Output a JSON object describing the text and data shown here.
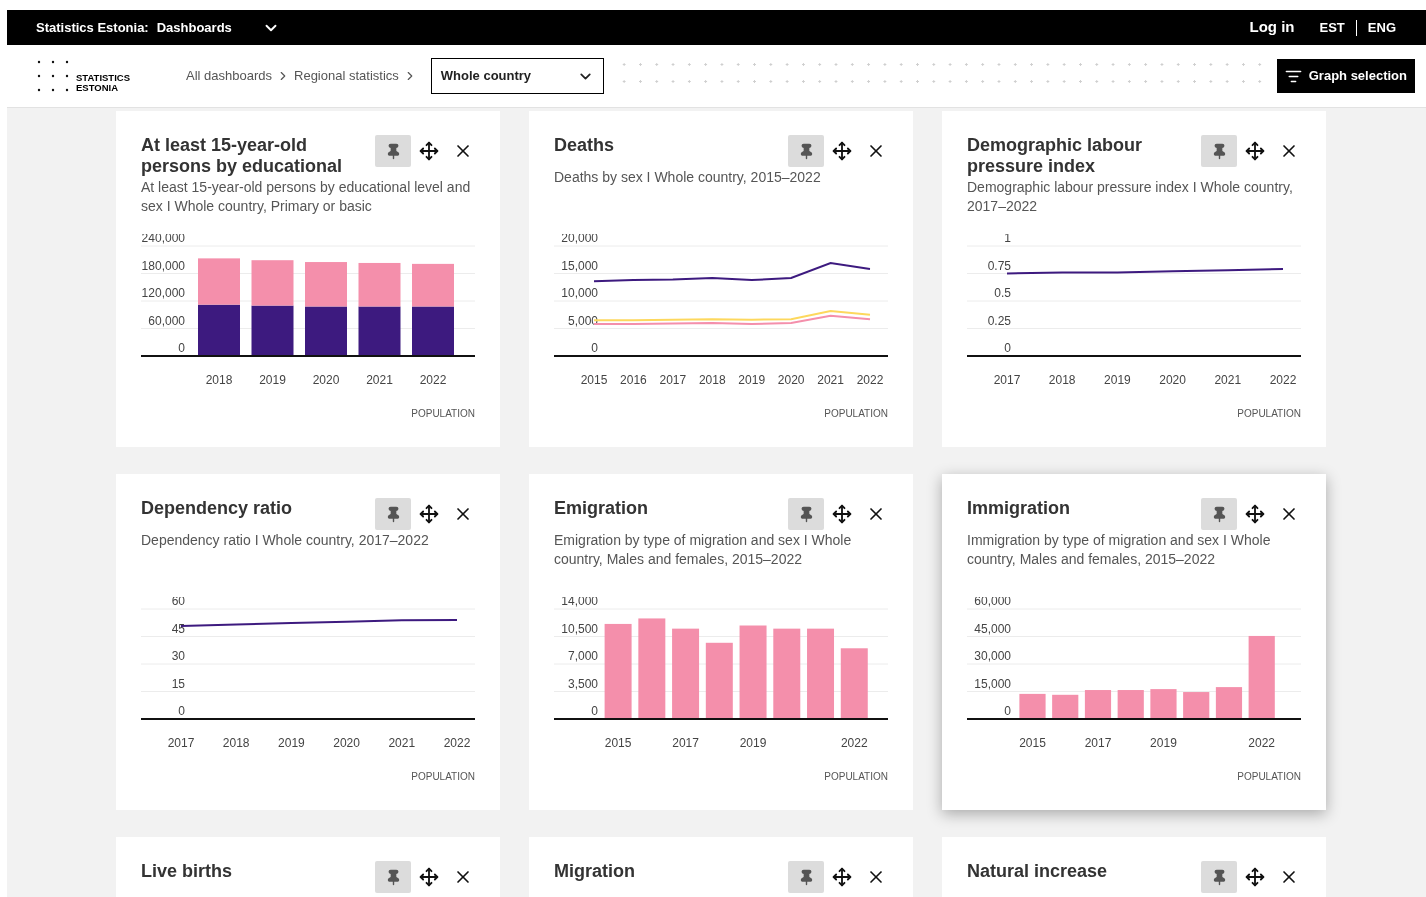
{
  "topbar": {
    "brand": "Statistics Estonia:",
    "section": "Dashboards",
    "login": "Log in",
    "languages": [
      "EST",
      "ENG"
    ]
  },
  "logo": {
    "lines": [
      "STATISTICS",
      "ESTONIA"
    ]
  },
  "breadcrumbs": [
    "All dashboards",
    "Regional statistics"
  ],
  "region_select": {
    "value": "Whole country"
  },
  "graph_selection_button": "Graph selection",
  "cards": [
    {
      "title": "At least 15-year-old persons by educational",
      "description": "At least 15-year-old persons by educational level and sex I Whole country, Primary or basic",
      "source": "POPULATION",
      "highlighted": false,
      "chart_data": {
        "type": "bar",
        "grid": true,
        "stacked": true,
        "categories": [
          "2018",
          "2019",
          "2020",
          "2021",
          "2022"
        ],
        "ylim": [
          0,
          240000
        ],
        "yticks": [
          {
            "value": 0,
            "label": "0"
          },
          {
            "value": 60000,
            "label": "60,000"
          },
          {
            "value": 120000,
            "label": "120,000"
          },
          {
            "value": 180000,
            "label": "180,000"
          },
          {
            "value": 240000,
            "label": "240,000"
          }
        ],
        "series": [
          {
            "color": "#3d1a7f",
            "values": [
              112000,
              110000,
              108000,
              108000,
              108000
            ]
          },
          {
            "color": "#f48fab",
            "values": [
              101000,
              99000,
              97000,
              95000,
              93000
            ]
          }
        ]
      }
    },
    {
      "title": "Deaths",
      "description": "Deaths by sex I Whole country, 2015–2022",
      "source": "POPULATION",
      "highlighted": false,
      "chart_data": {
        "type": "line",
        "grid": true,
        "categories": [
          "2015",
          "2016",
          "2017",
          "2018",
          "2019",
          "2020",
          "2021",
          "2022"
        ],
        "ylim": [
          0,
          20000
        ],
        "yticks": [
          {
            "value": 0,
            "label": "0"
          },
          {
            "value": 5000,
            "label": "5,000"
          },
          {
            "value": 10000,
            "label": "10,000"
          },
          {
            "value": 15000,
            "label": "15,000"
          },
          {
            "value": 20000,
            "label": "20,000"
          }
        ],
        "series": [
          {
            "color": "#3d1a7f",
            "values": [
              13600,
              13800,
              13900,
              14200,
              13800,
              14200,
              16900,
              15800
            ]
          },
          {
            "color": "#fdd85d",
            "values": [
              6500,
              6500,
              6600,
              6700,
              6600,
              6700,
              8200,
              7500
            ]
          },
          {
            "color": "#f48fab",
            "values": [
              5800,
              5800,
              5900,
              6000,
              5800,
              6000,
              7300,
              6700
            ]
          }
        ]
      }
    },
    {
      "title": "Demographic labour pressure index",
      "description": "Demographic labour pressure index I Whole country, 2017–2022",
      "source": "POPULATION",
      "highlighted": false,
      "chart_data": {
        "type": "line",
        "grid": true,
        "categories": [
          "2017",
          "2018",
          "2019",
          "2020",
          "2021",
          "2022"
        ],
        "ylim": [
          0,
          1
        ],
        "yticks": [
          {
            "value": 0,
            "label": "0"
          },
          {
            "value": 0.25,
            "label": "0.25"
          },
          {
            "value": 0.5,
            "label": "0.5"
          },
          {
            "value": 0.75,
            "label": "0.75"
          },
          {
            "value": 1,
            "label": "1"
          }
        ],
        "series": [
          {
            "color": "#3d1a7f",
            "values": [
              0.75,
              0.76,
              0.76,
              0.77,
              0.78,
              0.79
            ]
          }
        ]
      }
    },
    {
      "title": "Dependency ratio",
      "description": "Dependency ratio I Whole country, 2017–2022",
      "source": "POPULATION",
      "highlighted": false,
      "chart_data": {
        "type": "line",
        "grid": true,
        "categories": [
          "2017",
          "2018",
          "2019",
          "2020",
          "2021",
          "2022"
        ],
        "ylim": [
          0,
          60
        ],
        "yticks": [
          {
            "value": 0,
            "label": "0"
          },
          {
            "value": 15,
            "label": "15"
          },
          {
            "value": 30,
            "label": "30"
          },
          {
            "value": 45,
            "label": "45"
          },
          {
            "value": 60,
            "label": "60"
          }
        ],
        "series": [
          {
            "color": "#3d1a7f",
            "values": [
              50.7,
              51.5,
              52.3,
              53.0,
              53.8,
              54.0
            ]
          }
        ]
      }
    },
    {
      "title": "Emigration",
      "description": "Emigration by type of migration and sex I Whole country, Males and females, 2015–2022",
      "source": "POPULATION",
      "highlighted": false,
      "chart_data": {
        "type": "bar",
        "grid": true,
        "x": [
          2015,
          2016,
          2017,
          2018,
          2019,
          2020,
          2021,
          2022
        ],
        "xlim": [
          2013.1,
          2023
        ],
        "xticks": [
          2015,
          2017,
          2019,
          2022
        ],
        "ylim": [
          0,
          14000
        ],
        "yticks": [
          {
            "value": 0,
            "label": "0"
          },
          {
            "value": 3500,
            "label": "3,500"
          },
          {
            "value": 7000,
            "label": "7,000"
          },
          {
            "value": 10500,
            "label": "10,500"
          },
          {
            "value": 14000,
            "label": "14,000"
          }
        ],
        "series": [
          {
            "color": "#f48fab",
            "values": [
              12100,
              12800,
              11500,
              9700,
              11900,
              11500,
              11500,
              9000
            ]
          }
        ]
      }
    },
    {
      "title": "Immigration",
      "description": "Immigration by type of migration and sex I Whole country, Males and females, 2015–2022",
      "source": "POPULATION",
      "highlighted": true,
      "chart_data": {
        "type": "bar",
        "grid": true,
        "x": [
          2015,
          2016,
          2017,
          2018,
          2019,
          2020,
          2021,
          2022
        ],
        "xlim": [
          2013,
          2023.2
        ],
        "xticks": [
          2015,
          2017,
          2019,
          2022
        ],
        "ylim": [
          0,
          60000
        ],
        "yticks": [
          {
            "value": 0,
            "label": "0"
          },
          {
            "value": 15000,
            "label": "15,000"
          },
          {
            "value": 30000,
            "label": "30,000"
          },
          {
            "value": 45000,
            "label": "45,000"
          },
          {
            "value": 60000,
            "label": "60,000"
          }
        ],
        "series": [
          {
            "color": "#f48fab",
            "values": [
              13700,
              13200,
              15800,
              15800,
              16300,
              14700,
              17400,
              45300
            ]
          }
        ]
      }
    },
    {
      "title": "Live births",
      "highlighted": false
    },
    {
      "title": "Migration",
      "highlighted": false
    },
    {
      "title": "Natural increase",
      "highlighted": false
    }
  ]
}
